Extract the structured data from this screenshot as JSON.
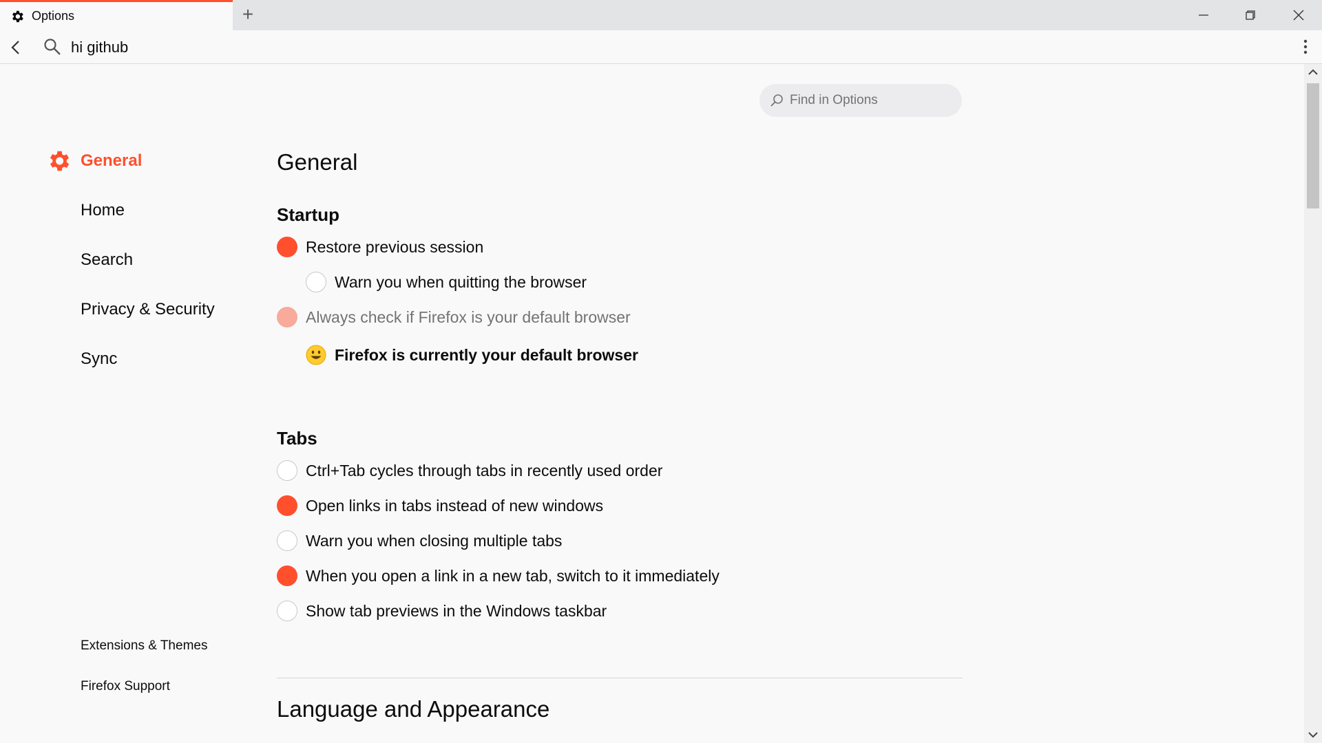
{
  "tab": {
    "title": "Options",
    "icon": "gear-icon"
  },
  "toolbar": {
    "url_text": "hi github"
  },
  "find": {
    "placeholder": "Find in Options"
  },
  "sidebar": {
    "categories": [
      {
        "label": "General",
        "selected": true,
        "icon": "gear-icon"
      },
      {
        "label": "Home"
      },
      {
        "label": "Search"
      },
      {
        "label": "Privacy & Security"
      },
      {
        "label": "Sync"
      }
    ],
    "footer": [
      {
        "label": "Extensions & Themes"
      },
      {
        "label": "Firefox Support"
      }
    ]
  },
  "main": {
    "page_title": "General",
    "startup": {
      "heading": "Startup",
      "options": [
        {
          "label": "Restore previous session",
          "checked": true
        },
        {
          "label": "Warn you when quitting the browser",
          "checked": false
        },
        {
          "label": "Always check if Firefox is your default browser",
          "checked": true,
          "disabled": true
        }
      ],
      "default_status": "Firefox is currently your default browser"
    },
    "tabs": {
      "heading": "Tabs",
      "options": [
        {
          "label": "Ctrl+Tab cycles through tabs in recently used order",
          "checked": false
        },
        {
          "label": "Open links in tabs instead of new windows",
          "checked": true
        },
        {
          "label": "Warn you when closing multiple tabs",
          "checked": false
        },
        {
          "label": "When you open a link in a new tab, switch to it immediately",
          "checked": true
        },
        {
          "label": "Show tab previews in the Windows taskbar",
          "checked": false
        }
      ]
    },
    "language_heading": "Language and Appearance"
  },
  "colors": {
    "accent": "#ff4f2d",
    "accent_disabled": "#f8aa9b",
    "background": "#f9f9fa"
  }
}
